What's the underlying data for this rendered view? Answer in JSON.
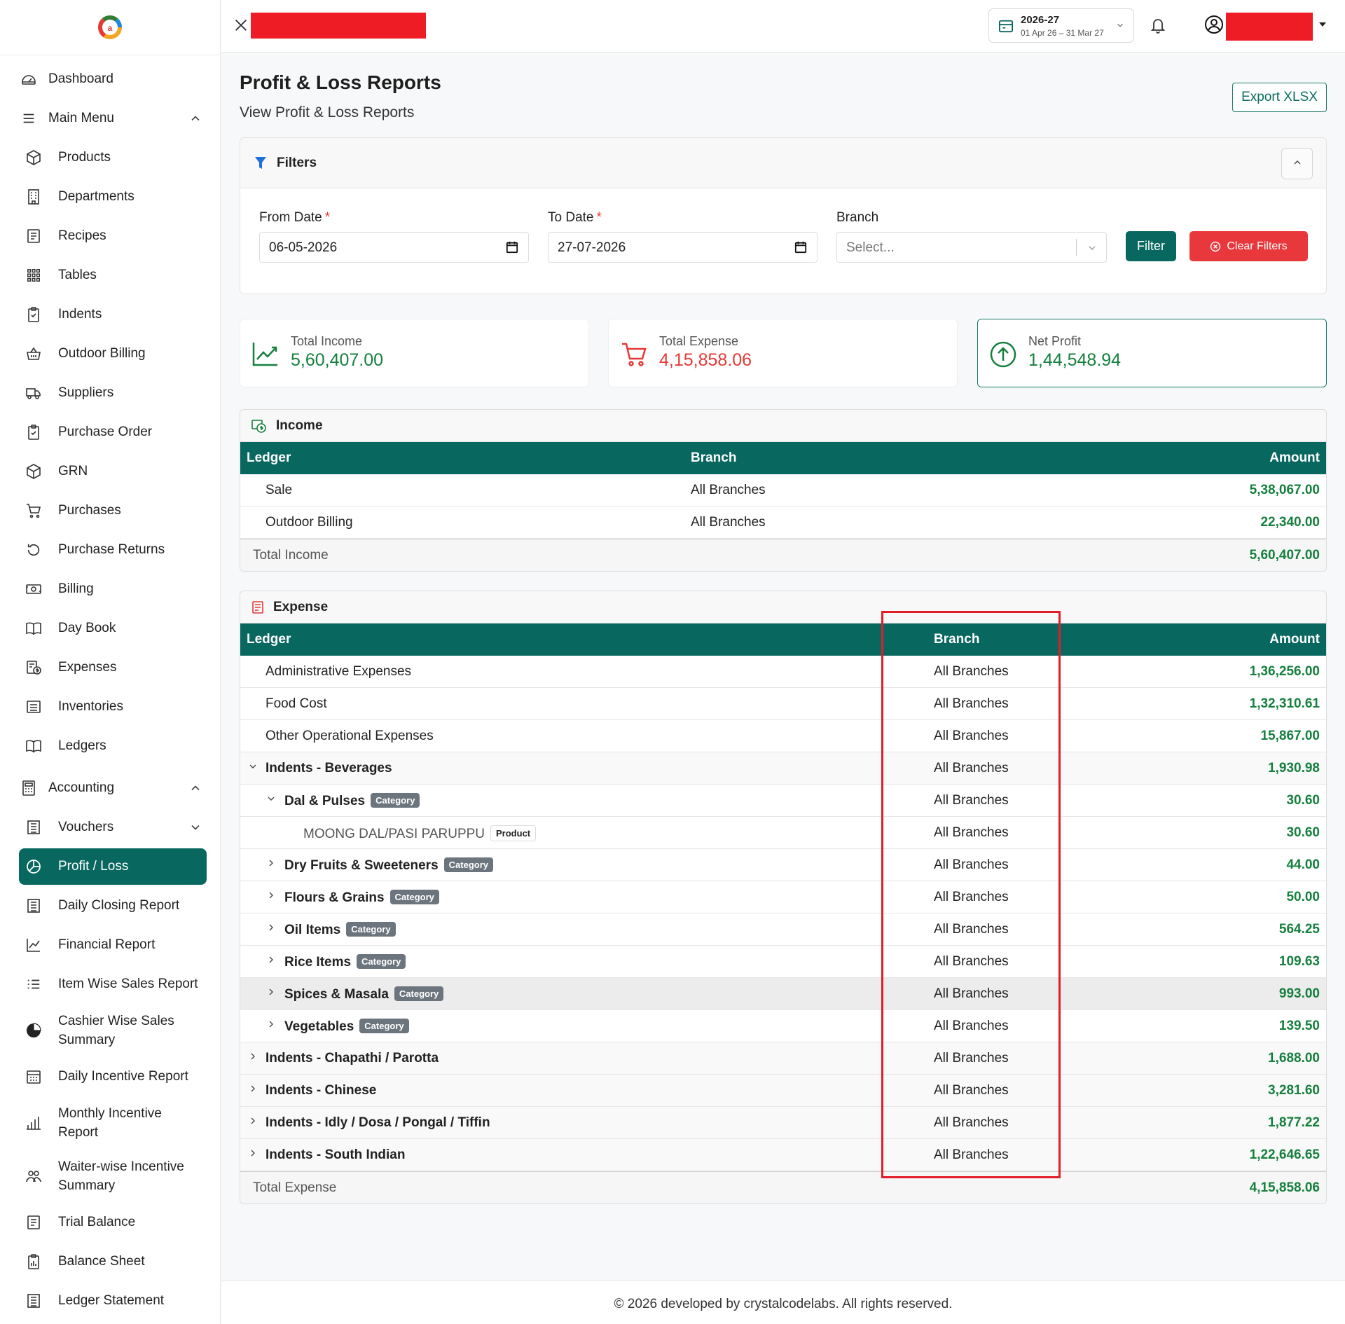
{
  "sidebar": {
    "items": [
      {
        "label": "Dashboard"
      },
      {
        "label": "Main Menu"
      },
      {
        "label": "Products"
      },
      {
        "label": "Departments"
      },
      {
        "label": "Recipes"
      },
      {
        "label": "Tables"
      },
      {
        "label": "Indents"
      },
      {
        "label": "Outdoor Billing"
      },
      {
        "label": "Suppliers"
      },
      {
        "label": "Purchase Order"
      },
      {
        "label": "GRN"
      },
      {
        "label": "Purchases"
      },
      {
        "label": "Purchase Returns"
      },
      {
        "label": "Billing"
      },
      {
        "label": "Day Book"
      },
      {
        "label": "Expenses"
      },
      {
        "label": "Inventories"
      },
      {
        "label": "Ledgers"
      },
      {
        "label": "Accounting"
      },
      {
        "label": "Vouchers"
      },
      {
        "label": "Profit / Loss"
      },
      {
        "label": "Daily Closing Report"
      },
      {
        "label": "Financial Report"
      },
      {
        "label": "Item Wise Sales Report"
      },
      {
        "label": "Cashier Wise Sales Summary"
      },
      {
        "label": "Daily Incentive Report"
      },
      {
        "label": "Monthly Incentive Report"
      },
      {
        "label": "Waiter-wise Incentive Summary"
      },
      {
        "label": "Trial Balance"
      },
      {
        "label": "Balance Sheet"
      },
      {
        "label": "Ledger Statement"
      }
    ]
  },
  "topbar": {
    "fy_label": "2026-27",
    "fy_range": "01 Apr 26 – 31 Mar 27"
  },
  "page": {
    "title": "Profit & Loss Reports",
    "subtitle": "View Profit & Loss Reports",
    "export_label": "Export XLSX"
  },
  "filters": {
    "title": "Filters",
    "from_label": "From Date",
    "from_value": "06-05-2026",
    "to_label": "To Date",
    "to_value": "27-07-2026",
    "branch_label": "Branch",
    "branch_placeholder": "Select...",
    "filter_label": "Filter",
    "clear_label": "Clear Filters"
  },
  "stats": {
    "income_label": "Total Income",
    "income_value": "5,60,407.00",
    "expense_label": "Total Expense",
    "expense_value": "4,15,858.06",
    "net_label": "Net Profit",
    "net_value": "1,44,548.94"
  },
  "colors": {
    "brand": "#08675f",
    "income": "#15803d",
    "expense": "#e53935",
    "highlight": "#e11d2a"
  },
  "income": {
    "title": "Income",
    "headers": [
      "Ledger",
      "Branch",
      "Amount"
    ],
    "rows": [
      {
        "ledger": "Sale",
        "branch": "All Branches",
        "amount": "5,38,067.00"
      },
      {
        "ledger": "Outdoor Billing",
        "branch": "All Branches",
        "amount": "22,340.00"
      }
    ],
    "total_label": "Total Income",
    "total_value": "5,60,407.00"
  },
  "expense": {
    "title": "Expense",
    "headers": [
      "Ledger",
      "Branch",
      "Amount"
    ],
    "rows": [
      {
        "ledger": "Administrative Expenses",
        "branch": "All Branches",
        "amount": "1,36,256.00"
      },
      {
        "ledger": "Food Cost",
        "branch": "All Branches",
        "amount": "1,32,310.61"
      },
      {
        "ledger": "Other Operational Expenses",
        "branch": "All Branches",
        "amount": "15,867.00"
      },
      {
        "ledger": "Indents - Beverages",
        "branch": "All Branches",
        "amount": "1,930.98"
      },
      {
        "ledger": "Dal & Pulses",
        "badge": "Category",
        "branch": "All Branches",
        "amount": "30.60"
      },
      {
        "ledger": "MOONG DAL/PASI PARUPPU",
        "badge": "Product",
        "branch": "All Branches",
        "amount": "30.60"
      },
      {
        "ledger": "Dry Fruits & Sweeteners",
        "badge": "Category",
        "branch": "All Branches",
        "amount": "44.00"
      },
      {
        "ledger": "Flours & Grains",
        "badge": "Category",
        "branch": "All Branches",
        "amount": "50.00"
      },
      {
        "ledger": "Oil Items",
        "badge": "Category",
        "branch": "All Branches",
        "amount": "564.25"
      },
      {
        "ledger": "Rice Items",
        "badge": "Category",
        "branch": "All Branches",
        "amount": "109.63"
      },
      {
        "ledger": "Spices & Masala",
        "badge": "Category",
        "branch": "All Branches",
        "amount": "993.00"
      },
      {
        "ledger": "Vegetables",
        "badge": "Category",
        "branch": "All Branches",
        "amount": "139.50"
      },
      {
        "ledger": "Indents - Chapathi / Parotta",
        "branch": "All Branches",
        "amount": "1,688.00"
      },
      {
        "ledger": "Indents - Chinese",
        "branch": "All Branches",
        "amount": "3,281.60"
      },
      {
        "ledger": "Indents - Idly / Dosa / Pongal / Tiffin",
        "branch": "All Branches",
        "amount": "1,877.22"
      },
      {
        "ledger": "Indents - South Indian",
        "branch": "All Branches",
        "amount": "1,22,646.65"
      }
    ],
    "total_label": "Total Expense",
    "total_value": "4,15,858.06"
  },
  "footer": {
    "text": "© 2026 developed by crystalcodelabs. All rights reserved."
  }
}
